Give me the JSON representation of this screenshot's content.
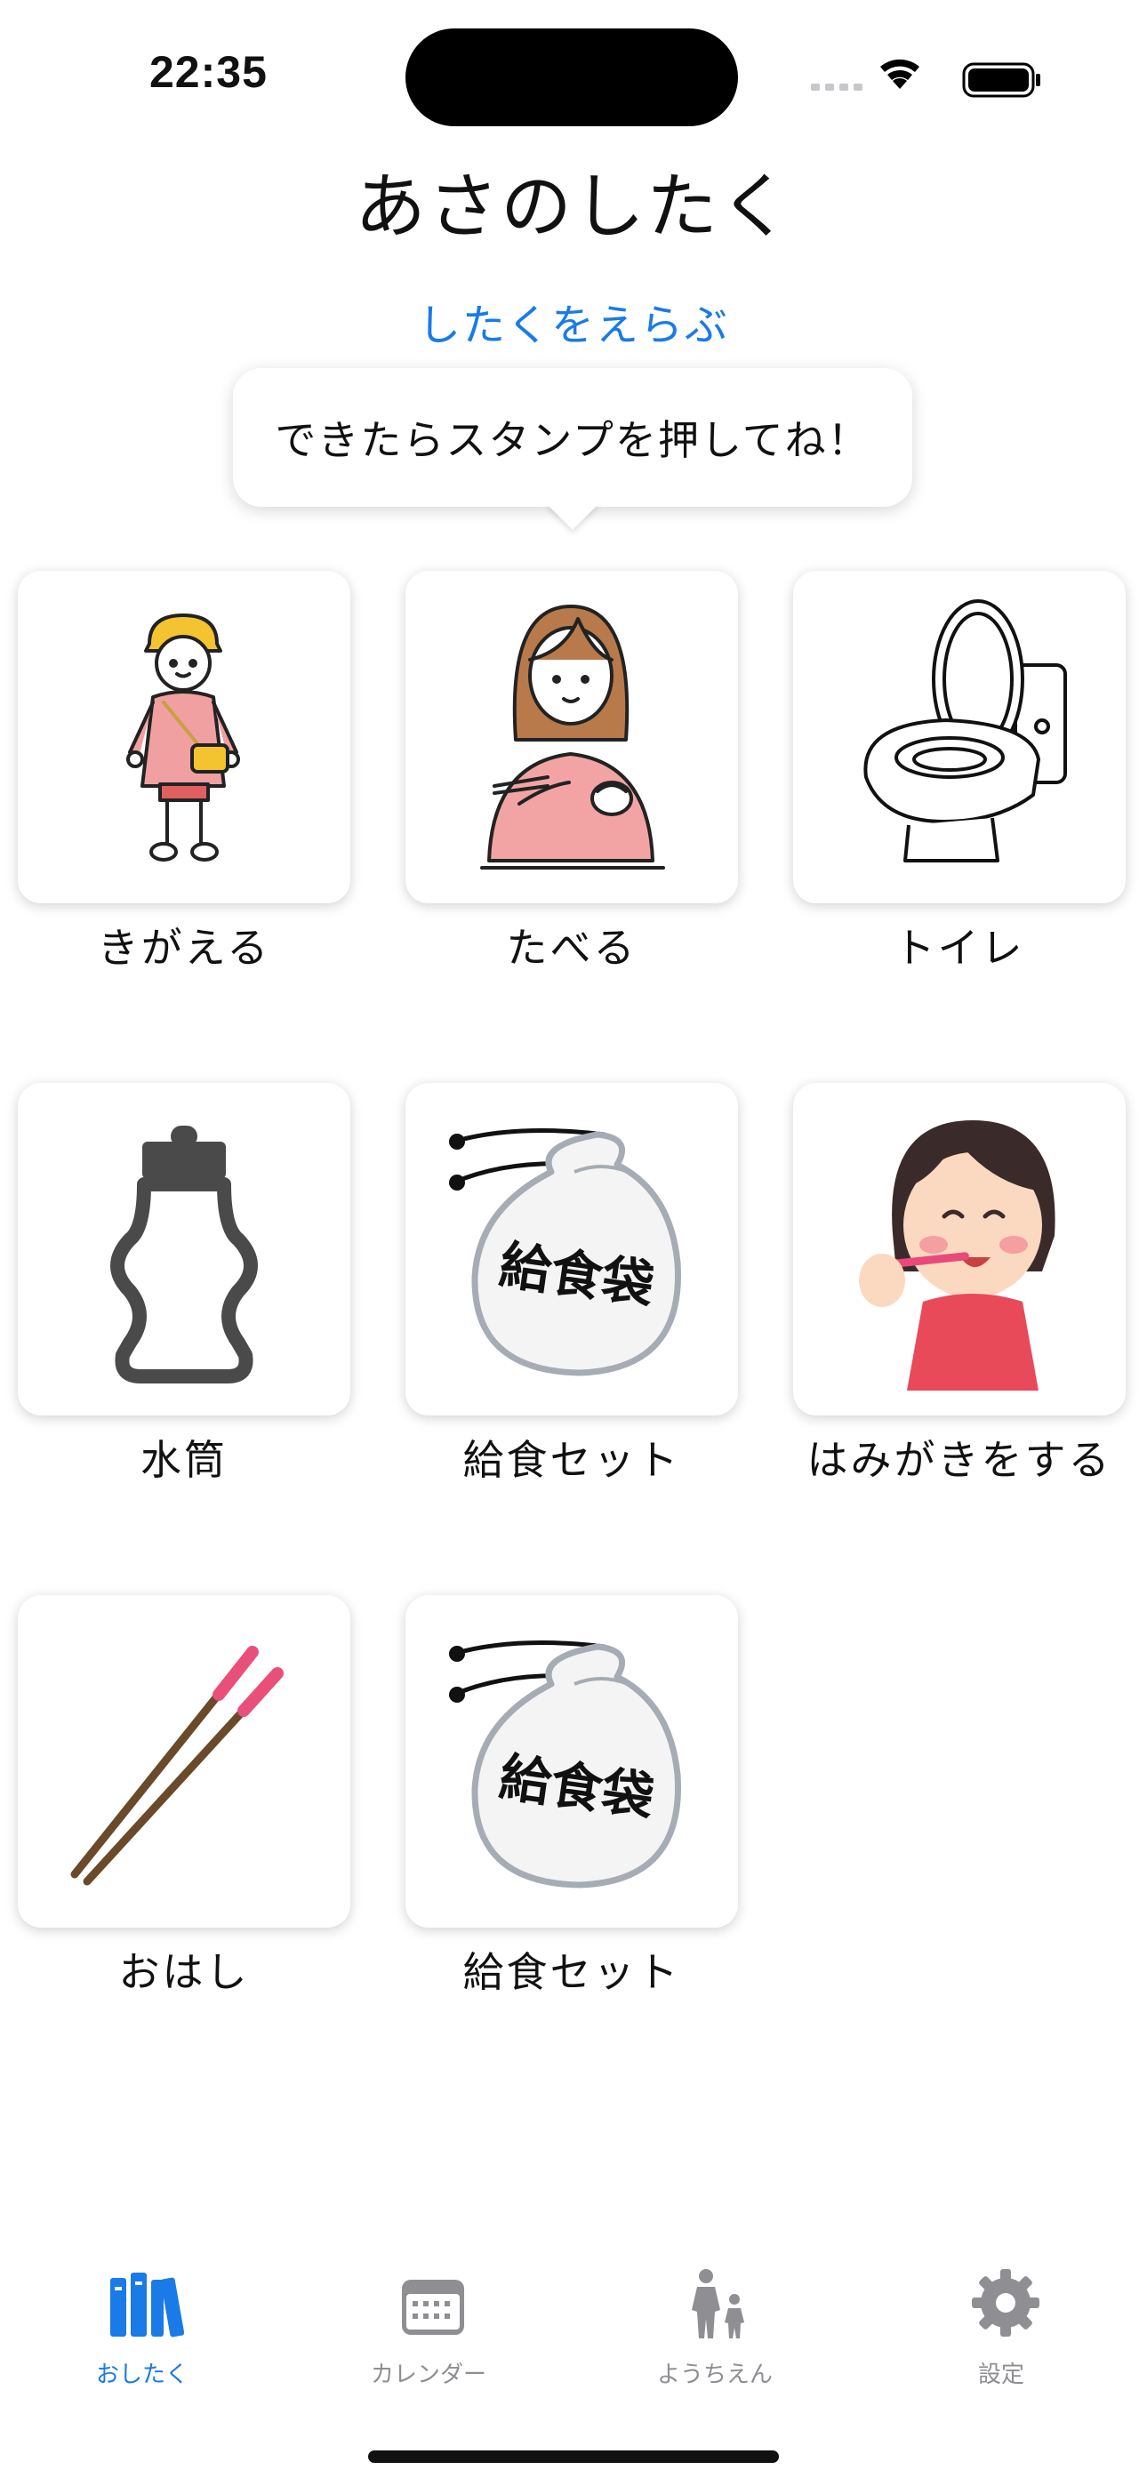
{
  "status_bar": {
    "time": "22:35"
  },
  "header": {
    "title": "あさのしたく",
    "subtitle_link": "したくをえらぶ"
  },
  "bubble": {
    "text": "できたらスタンプを押してね！"
  },
  "items": [
    {
      "label": "きがえる",
      "icon": "child-uniform-icon"
    },
    {
      "label": "たべる",
      "icon": "eating-person-icon"
    },
    {
      "label": "トイレ",
      "icon": "toilet-icon"
    },
    {
      "label": "水筒",
      "icon": "water-bottle-icon"
    },
    {
      "label": "給食セット",
      "icon": "lunch-bag-icon",
      "bag_text": "給食袋"
    },
    {
      "label": "はみがきをする",
      "icon": "toothbrushing-girl-icon"
    },
    {
      "label": "おはし",
      "icon": "chopsticks-icon"
    },
    {
      "label": "給食セット",
      "icon": "lunch-bag-icon",
      "bag_text": "給食袋"
    }
  ],
  "tabs": [
    {
      "label": "おしたく",
      "icon": "books-icon",
      "active": true
    },
    {
      "label": "カレンダー",
      "icon": "calendar-icon",
      "active": false
    },
    {
      "label": "ようちえん",
      "icon": "parent-child-icon",
      "active": false
    },
    {
      "label": "設定",
      "icon": "gear-icon",
      "active": false
    }
  ],
  "colors": {
    "accent": "#1a7ae8",
    "inactive_tab": "#8e8e93",
    "text": "#111111"
  }
}
